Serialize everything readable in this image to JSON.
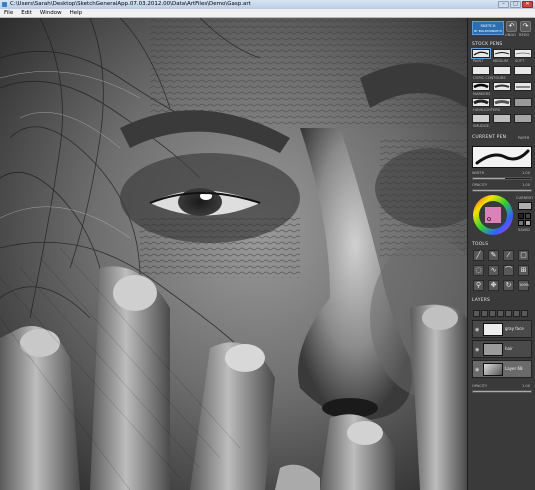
{
  "window": {
    "title": "C:\\Users\\Sarah\\Desktop\\SketchGeneralApp.07.03.2012.00\\Data\\ArtFiles\\Demo\\Gasp.art",
    "controls": [
      "–",
      "□",
      "✕"
    ]
  },
  "menu": [
    "File",
    "Edit",
    "Window",
    "Help"
  ],
  "panel": {
    "logo_line1": "SKETCH",
    "logo_line2": "BY BOLDMONKEYS",
    "undo_label": "UNDO",
    "redo_label": "REDO",
    "stock_pens": {
      "title": "STOCK PENS",
      "labels": [
        "PAINT",
        "MEDIUM",
        "SOFT"
      ]
    },
    "copic_markers_label": "COPIC CONTOURS",
    "markers_label": "MARKERS",
    "highlights_label": "HIGHLIGHTERS",
    "smudge_label": "SMUDGE",
    "current_pen": {
      "title": "CURRENT PEN",
      "paper_label": "PAPER",
      "width_label": "WIDTH",
      "opacity_label": "OPACITY",
      "width_value": "1.00",
      "opacity_value": "1.00"
    },
    "color": {
      "current_label": "CURRENT",
      "saved_label": "SAVED",
      "selected": "#b0b0b0"
    },
    "tools": {
      "title": "TOOLS",
      "icons": [
        "brush-icon",
        "pencil-icon",
        "line-icon",
        "fill-icon",
        "lasso-icon",
        "smudge-icon",
        "curve-icon",
        "transform-icon",
        "zoom-icon",
        "move-icon",
        "rotate-icon",
        "reset-view-icon"
      ],
      "zoom_text": "100%"
    },
    "layers": {
      "title": "LAYERS",
      "items": [
        {
          "name": "gray face"
        },
        {
          "name": "hair"
        },
        {
          "name": "Layer 68"
        }
      ],
      "opacity_label": "OPACITY",
      "opacity_value": "1.00"
    }
  }
}
